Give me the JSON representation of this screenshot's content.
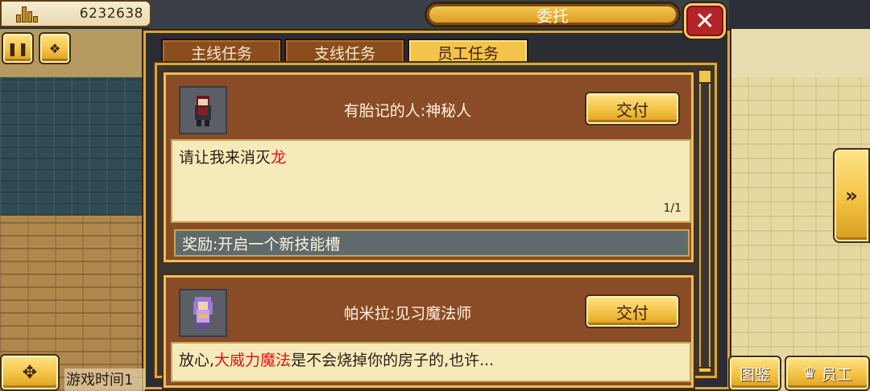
{
  "top_bar": {
    "money_amount": "6232638"
  },
  "dialog": {
    "title": "委托",
    "tabs": [
      {
        "label": "主线任务",
        "active": false
      },
      {
        "label": "支线任务",
        "active": false
      },
      {
        "label": "员工任务",
        "active": true
      }
    ]
  },
  "quests": [
    {
      "name": "有胎记的人:神秘人",
      "deliver_label": "交付",
      "desc_pre": "请让我来消灭",
      "desc_highlight": "龙",
      "desc_post": "",
      "progress": "1/1",
      "reward": "奖励:开启一个新技能槽"
    },
    {
      "name": "帕米拉:见习魔法师",
      "deliver_label": "交付",
      "desc_pre": "放心,",
      "desc_highlight": "大威力魔法",
      "desc_post": "是不会烧掉你的房子的,也许..."
    }
  ],
  "bottom": {
    "game_time": "游戏时间1",
    "encyclopedia_label": "图鉴",
    "staff_label": "员工"
  },
  "colors": {
    "highlight": "#e01414",
    "gold": "#f3c244",
    "card_brown": "#8a4c26",
    "close_red": "#b4242a"
  },
  "icons": [
    "building-icon",
    "pause-icon",
    "gems-icon",
    "close-icon",
    "fast-forward-icon",
    "dpad-icon",
    "crown-icon"
  ]
}
